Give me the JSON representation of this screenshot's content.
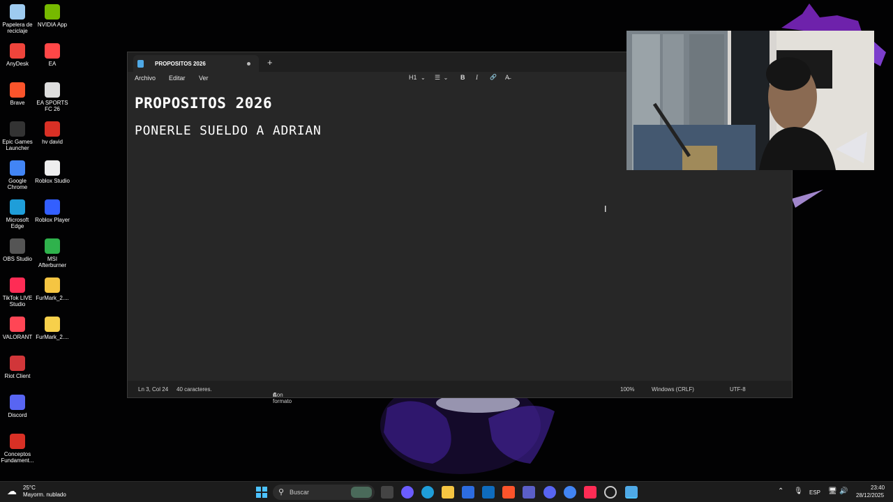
{
  "desktop_icons": [
    {
      "label": "Papelera de reciclaje",
      "icon": "recycle-bin-icon",
      "color": "#9ecbf0"
    },
    {
      "label": "NVIDIA App",
      "icon": "nvidia-icon",
      "color": "#76b900"
    },
    {
      "label": "AnyDesk",
      "icon": "anydesk-icon",
      "color": "#ef443b"
    },
    {
      "label": "EA",
      "icon": "ea-icon",
      "color": "#ff4747"
    },
    {
      "label": "Brave",
      "icon": "brave-icon",
      "color": "#fb542b"
    },
    {
      "label": "EA SPORTS FC 26",
      "icon": "ea-sports-fc-icon",
      "color": "#dddddd"
    },
    {
      "label": "Epic Games Launcher",
      "icon": "epic-games-icon",
      "color": "#333333"
    },
    {
      "label": "hv david",
      "icon": "pdf-icon",
      "color": "#d93025"
    },
    {
      "label": "Google Chrome",
      "icon": "chrome-icon",
      "color": "#4285f4"
    },
    {
      "label": "Roblox Studio",
      "icon": "roblox-studio-icon",
      "color": "#eeeeee"
    },
    {
      "label": "Microsoft Edge",
      "icon": "edge-icon",
      "color": "#1f9ed9"
    },
    {
      "label": "Roblox Player",
      "icon": "roblox-player-icon",
      "color": "#335fff"
    },
    {
      "label": "OBS Studio",
      "icon": "obs-icon",
      "color": "#555555"
    },
    {
      "label": "MSI Afterburner",
      "icon": "msi-afterburner-icon",
      "color": "#2fb24c"
    },
    {
      "label": "TikTok LIVE Studio",
      "icon": "tiktok-live-icon",
      "color": "#fe2c55"
    },
    {
      "label": "FurMark_2....",
      "icon": "folder-zip-icon",
      "color": "#f5c542"
    },
    {
      "label": "VALORANT",
      "icon": "valorant-icon",
      "color": "#ff4655"
    },
    {
      "label": "FurMark_2....",
      "icon": "folder-icon",
      "color": "#f7d04b"
    },
    {
      "label": "Riot Client",
      "icon": "riot-client-icon",
      "color": "#d13639"
    },
    {
      "label": "Discord",
      "icon": "discord-icon",
      "color": "#5865f2"
    },
    {
      "label": "Conceptos Fundament...",
      "icon": "pdf-icon",
      "color": "#d93025"
    }
  ],
  "notepad": {
    "tab_title": "PROPOSITOS 2026",
    "new_tab": "+",
    "menu": [
      "Archivo",
      "Editar",
      "Ver"
    ],
    "toolbar": {
      "heading": "H1",
      "chevron": "⌄",
      "list": "☰",
      "bold": "B",
      "italic": "I",
      "link": "🔗",
      "clear": "A̶"
    },
    "content": {
      "heading": "PROPOSITOS 2026",
      "line": "PONERLE SUELDO A ADRIAN"
    },
    "status": {
      "position": "Ln 3, Col 24",
      "chars": "40 caracteres.",
      "format": "Con formato",
      "zoom": "100%",
      "line_ending": "Windows (CRLF)",
      "encoding": "UTF-8"
    }
  },
  "taskbar": {
    "weather_temp": "25°C",
    "weather_desc": "Mayorm. nublado",
    "search_placeholder": "Buscar",
    "lang": "ESP",
    "time": "23:40",
    "date": "28/12/2025"
  }
}
